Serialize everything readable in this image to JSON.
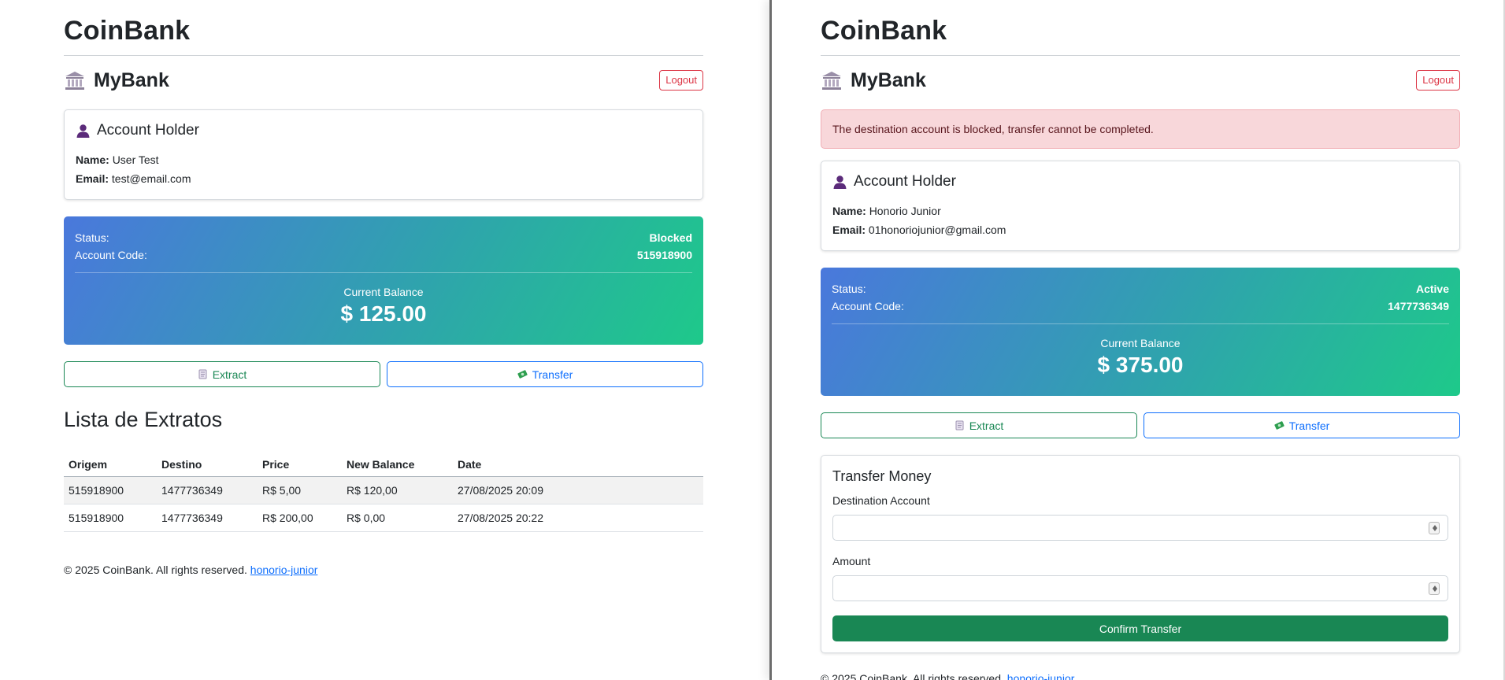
{
  "left": {
    "brand": "CoinBank",
    "nav_title": "MyBank",
    "logout_label": "Logout",
    "holder": {
      "title": "Account Holder",
      "name_label": "Name:",
      "name": "User Test",
      "email_label": "Email:",
      "email": "test@email.com"
    },
    "balance": {
      "status_label": "Status:",
      "status": "Blocked",
      "code_label": "Account Code:",
      "code": "515918900",
      "balance_label": "Current Balance",
      "amount": "$ 125.00"
    },
    "actions": {
      "extract": "Extract",
      "transfer": "Transfer"
    },
    "statements": {
      "title": "Lista de Extratos",
      "headers": [
        "Origem",
        "Destino",
        "Price",
        "New Balance",
        "Date"
      ],
      "rows": [
        [
          "515918900",
          "1477736349",
          "R$ 5,00",
          "R$ 120,00",
          "27/08/2025 20:09"
        ],
        [
          "515918900",
          "1477736349",
          "R$ 200,00",
          "R$ 0,00",
          "27/08/2025 20:22"
        ]
      ]
    },
    "footer": {
      "text": "© 2025 CoinBank. All rights reserved. ",
      "link": "honorio-junior"
    }
  },
  "right": {
    "brand": "CoinBank",
    "nav_title": "MyBank",
    "logout_label": "Logout",
    "alert": "The destination account is blocked, transfer cannot be completed.",
    "holder": {
      "title": "Account Holder",
      "name_label": "Name:",
      "name": "Honorio Junior",
      "email_label": "Email:",
      "email": "01honoriojunior@gmail.com"
    },
    "balance": {
      "status_label": "Status:",
      "status": "Active",
      "code_label": "Account Code:",
      "code": "1477736349",
      "balance_label": "Current Balance",
      "amount": "$ 375.00"
    },
    "actions": {
      "extract": "Extract",
      "transfer": "Transfer"
    },
    "transfer_form": {
      "title": "Transfer Money",
      "destination_label": "Destination Account",
      "destination_value": "",
      "amount_label": "Amount",
      "amount_value": "",
      "confirm_label": "Confirm Transfer"
    },
    "footer": {
      "text": "© 2025 CoinBank. All rights reserved. ",
      "link": "honorio-junior"
    }
  },
  "colors": {
    "primary": "#0d6efd",
    "success": "#198754",
    "danger": "#dc3545",
    "alert_bg": "#f8d7da",
    "gradient_start": "#4a78dc",
    "gradient_end": "#1ec98a"
  }
}
